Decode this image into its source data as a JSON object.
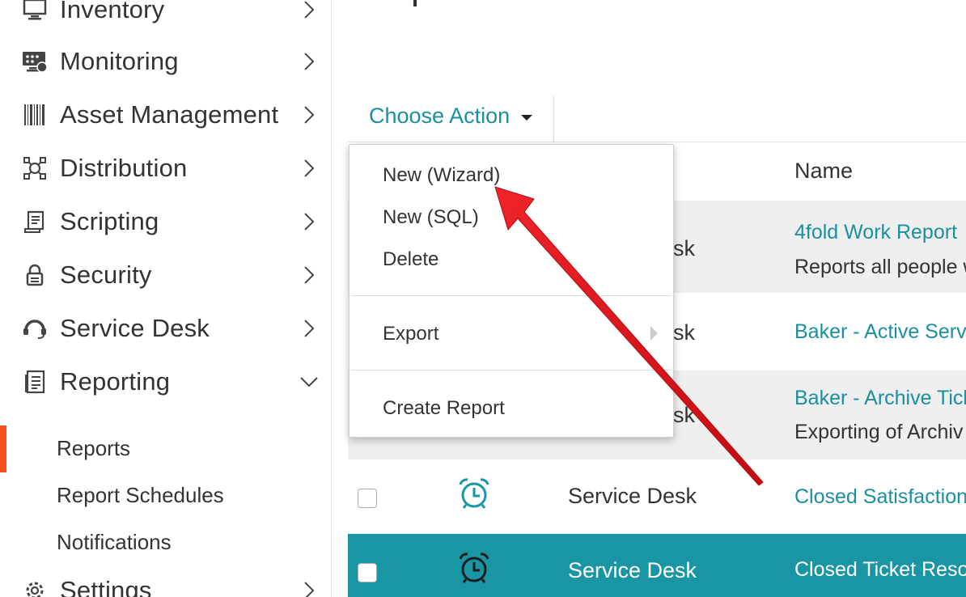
{
  "sidebar": {
    "items": [
      {
        "label": "Inventory",
        "icon": "monitor-icon"
      },
      {
        "label": "Monitoring",
        "icon": "monitoring-icon"
      },
      {
        "label": "Asset Management",
        "icon": "barcode-icon"
      },
      {
        "label": "Distribution",
        "icon": "distribution-icon"
      },
      {
        "label": "Scripting",
        "icon": "script-icon"
      },
      {
        "label": "Security",
        "icon": "lock-icon"
      },
      {
        "label": "Service Desk",
        "icon": "headset-icon"
      },
      {
        "label": "Reporting",
        "icon": "report-icon"
      }
    ],
    "subitems": [
      {
        "label": "Reports",
        "active": true
      },
      {
        "label": "Report Schedules"
      },
      {
        "label": "Notifications"
      }
    ],
    "bottom_item": {
      "label": "Settings",
      "icon": "gear-icon"
    },
    "active_color": "#f4511e"
  },
  "toolbar": {
    "choose_action_label": "Choose Action"
  },
  "dropdown": {
    "items": {
      "new_wizard": "New (Wizard)",
      "new_sql": "New (SQL)",
      "delete": "Delete",
      "export": "Export",
      "create_report": "Create Report"
    }
  },
  "table": {
    "name_header": "Name",
    "rows": [
      {
        "category": "sk",
        "name": "4fold Work Report",
        "description": "Reports all people w"
      },
      {
        "category": "sk",
        "name": "Baker - Active Servi",
        "description": ""
      },
      {
        "category": "sk",
        "name": "Baker - Archive Tick",
        "description": "Exporting of Archiv"
      },
      {
        "category": "Service Desk",
        "name": "Closed Satisfaction",
        "description": ""
      },
      {
        "category": "Service Desk",
        "name": "Closed Ticket Resol",
        "description": ""
      }
    ]
  },
  "colors": {
    "accent": "#1a8fa0",
    "selected_row": "#1a95a3",
    "annotation_arrow": "#e0101a"
  }
}
